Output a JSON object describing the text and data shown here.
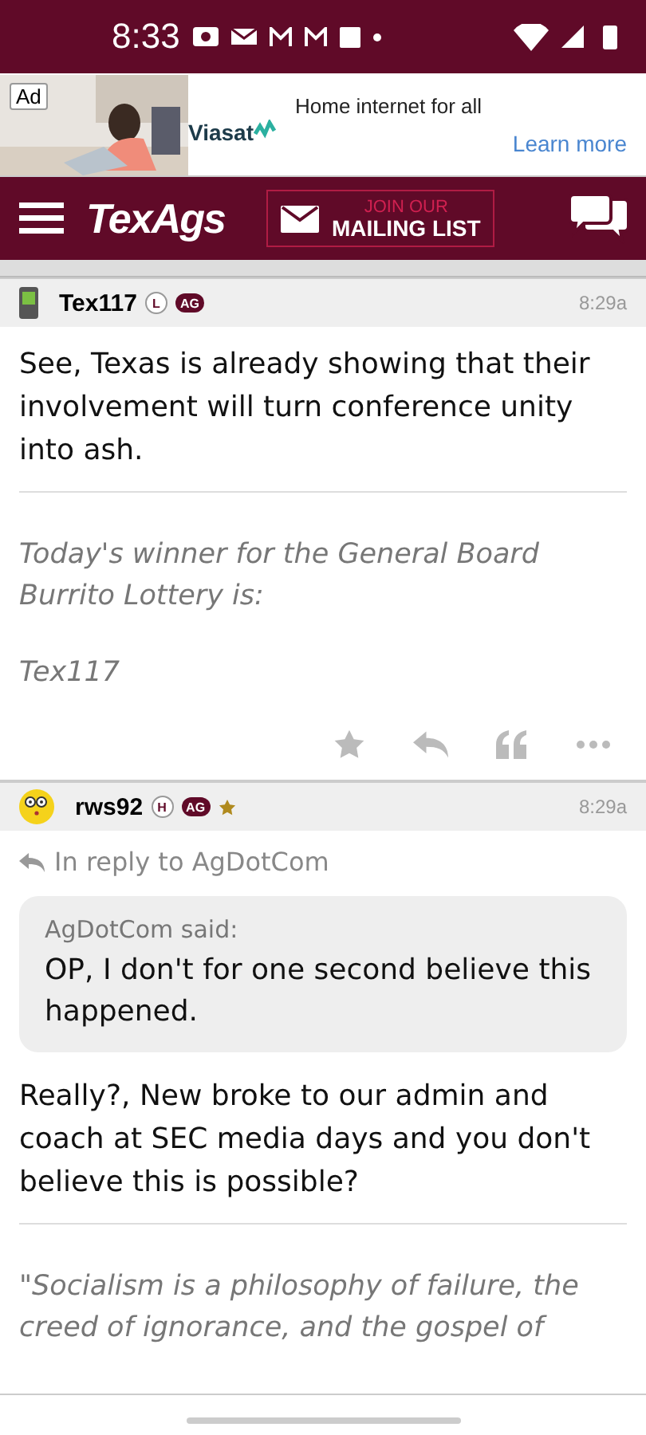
{
  "status_bar": {
    "time": "8:33"
  },
  "ad": {
    "label": "Ad",
    "brand": "Viasat",
    "headline": "Home internet for all",
    "cta": "Learn more"
  },
  "header": {
    "logo": "TexAgs",
    "mailing_top": "JOIN OUR",
    "mailing_bottom": "MAILING LIST"
  },
  "posts": [
    {
      "kind": "phone",
      "author": "Tex117",
      "badges": [
        {
          "text": "L",
          "kind": "outline"
        },
        {
          "text": "AG",
          "kind": "filled"
        }
      ],
      "starred": false,
      "time": "8:29a",
      "body": "See, Texas is already showing that their involvement will turn conference unity into ash.",
      "signature": [
        "Today's winner for the General Board Burrito Lottery is:",
        "Tex117"
      ],
      "actions": true
    },
    {
      "kind": "emoji",
      "author": "rws92",
      "badges": [
        {
          "text": "H",
          "kind": "outline"
        },
        {
          "text": "AG",
          "kind": "filled"
        }
      ],
      "starred": true,
      "time": "8:29a",
      "reply_to": "In reply to AgDotCom",
      "quote": {
        "author": "AgDotCom said:",
        "text": "OP, I don't for one second believe this happened."
      },
      "body": "Really?, New broke to our admin and coach at SEC media days and you don't believe this is possible?",
      "signature": [
        "\"Socialism is a philosophy of failure, the creed of ignorance, and the gospel of"
      ],
      "actions": false
    }
  ]
}
